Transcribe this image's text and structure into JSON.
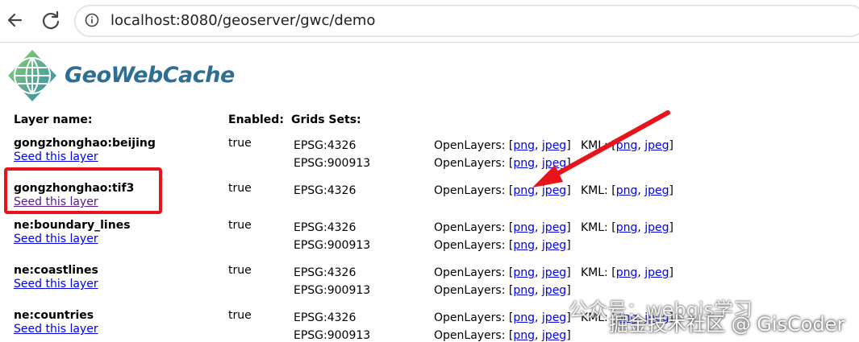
{
  "browser": {
    "url": "localhost:8080/geoserver/gwc/demo"
  },
  "app": {
    "logo_text": "GeoWebCache"
  },
  "table": {
    "headers": {
      "layer_name": "Layer name:",
      "enabled": "Enabled:",
      "grid_sets": "Grids Sets:"
    },
    "seed_label": "Seed this layer",
    "openlayers_label": "OpenLayers:",
    "kml_label": "KML:",
    "png_label": "png",
    "jpeg_label": "jpeg",
    "rows": [
      {
        "name": "gongzhonghao:beijing",
        "enabled": "true",
        "grids": [
          "EPSG:4326",
          "EPSG:900913"
        ]
      },
      {
        "name": "gongzhonghao:tif3",
        "enabled": "true",
        "grids": [
          "EPSG:4326"
        ]
      },
      {
        "name": "ne:boundary_lines",
        "enabled": "true",
        "grids": [
          "EPSG:4326",
          "EPSG:900913"
        ]
      },
      {
        "name": "ne:coastlines",
        "enabled": "true",
        "grids": [
          "EPSG:4326",
          "EPSG:900913"
        ]
      },
      {
        "name": "ne:countries",
        "enabled": "true",
        "grids": [
          "EPSG:4326",
          "EPSG:900913"
        ]
      }
    ]
  },
  "annotation": {
    "highlight_color": "#e8131b"
  },
  "watermark": {
    "line1": "公众号：webgis学习",
    "line2": "掘金技术社区 @ GisCoder"
  }
}
